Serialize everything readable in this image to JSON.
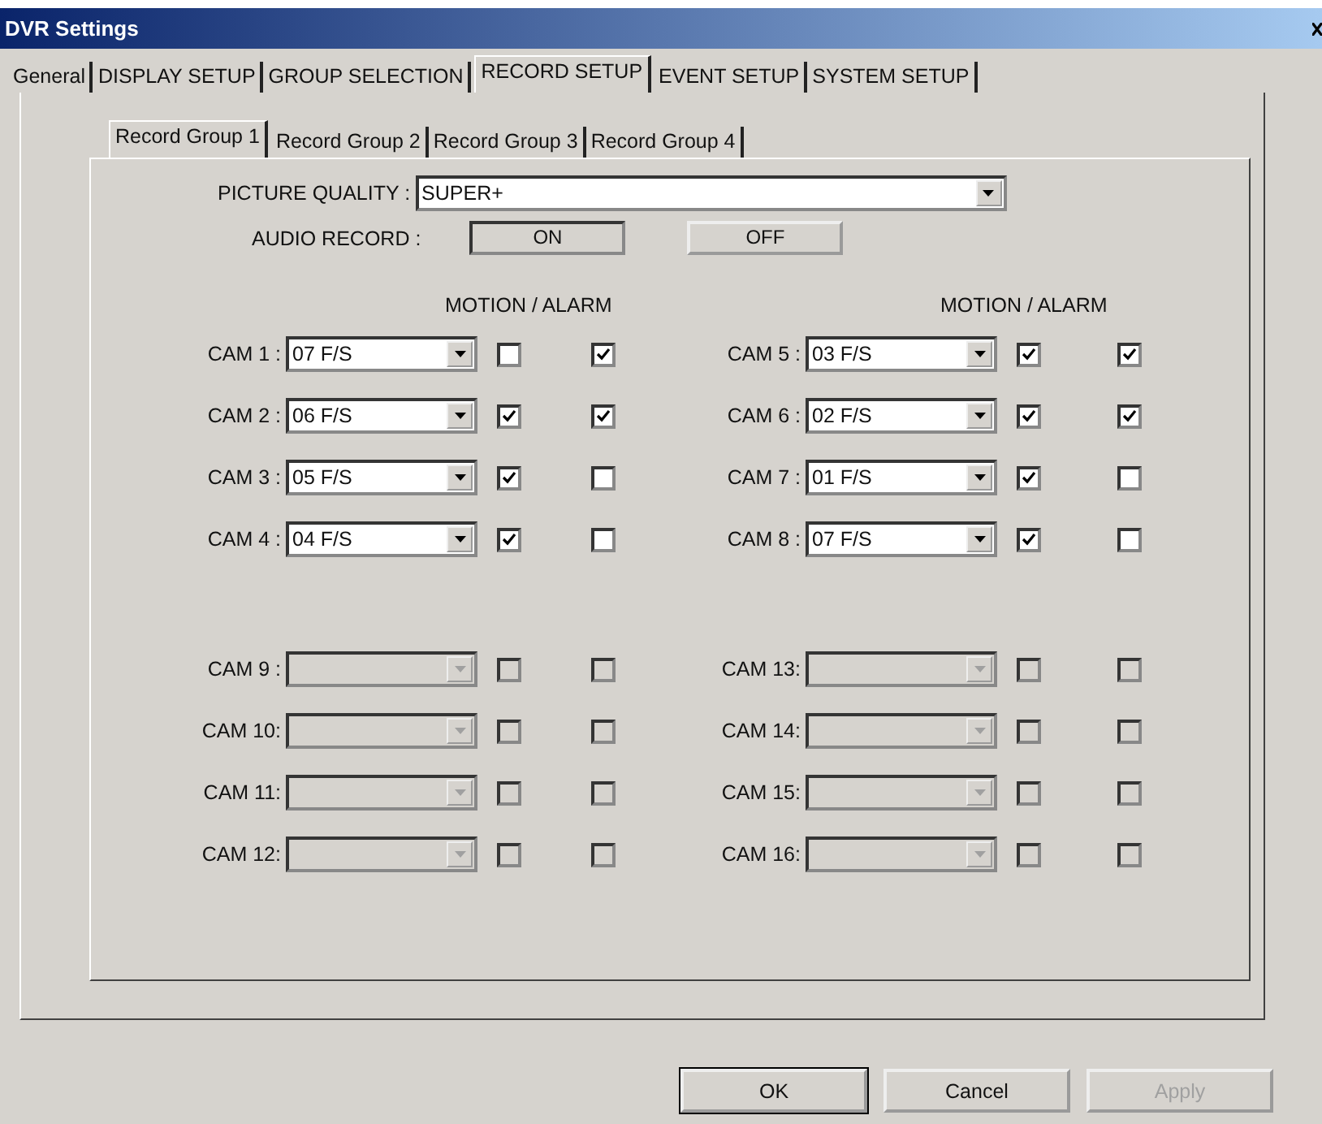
{
  "window": {
    "title": "DVR Settings"
  },
  "tabs": [
    {
      "label": "General",
      "selected": false
    },
    {
      "label": "DISPLAY SETUP",
      "selected": false
    },
    {
      "label": "GROUP SELECTION",
      "selected": false
    },
    {
      "label": "RECORD SETUP",
      "selected": true
    },
    {
      "label": "EVENT SETUP",
      "selected": false
    },
    {
      "label": "SYSTEM SETUP",
      "selected": false
    }
  ],
  "subtabs": [
    {
      "label": "Record Group 1",
      "selected": true
    },
    {
      "label": "Record Group 2",
      "selected": false
    },
    {
      "label": "Record Group 3",
      "selected": false
    },
    {
      "label": "Record Group 4",
      "selected": false
    }
  ],
  "picture_quality": {
    "label": "PICTURE QUALITY :",
    "value": "SUPER+"
  },
  "audio_record": {
    "label": "AUDIO RECORD :",
    "options": [
      {
        "label": "ON",
        "selected": true
      },
      {
        "label": "OFF",
        "selected": false
      }
    ]
  },
  "column_headers": [
    "MOTION / ALARM",
    "MOTION / ALARM"
  ],
  "cameras": [
    {
      "label": "CAM 1 :",
      "value": "07 F/S",
      "disabled": false,
      "motion": false,
      "alarm": true
    },
    {
      "label": "CAM 5 :",
      "value": "03 F/S",
      "disabled": false,
      "motion": true,
      "alarm": true
    },
    {
      "label": "CAM 2 :",
      "value": "06 F/S",
      "disabled": false,
      "motion": true,
      "alarm": true
    },
    {
      "label": "CAM 6 :",
      "value": "02 F/S",
      "disabled": false,
      "motion": true,
      "alarm": true
    },
    {
      "label": "CAM 3 :",
      "value": "05 F/S",
      "disabled": false,
      "motion": true,
      "alarm": false
    },
    {
      "label": "CAM 7 :",
      "value": "01 F/S",
      "disabled": false,
      "motion": true,
      "alarm": false
    },
    {
      "label": "CAM 4 :",
      "value": "04 F/S",
      "disabled": false,
      "motion": true,
      "alarm": false
    },
    {
      "label": "CAM 8 :",
      "value": "07 F/S",
      "disabled": false,
      "motion": true,
      "alarm": false
    },
    {
      "label": "CAM 9 :",
      "disabled": true,
      "motion": false,
      "alarm": false
    },
    {
      "label": "CAM 13:",
      "disabled": true,
      "motion": false,
      "alarm": false
    },
    {
      "label": "CAM 10:",
      "disabled": true,
      "motion": false,
      "alarm": false
    },
    {
      "label": "CAM 14:",
      "disabled": true,
      "motion": false,
      "alarm": false
    },
    {
      "label": "CAM 11:",
      "disabled": true,
      "motion": false,
      "alarm": false
    },
    {
      "label": "CAM 15:",
      "disabled": true,
      "motion": false,
      "alarm": false
    },
    {
      "label": "CAM 12:",
      "disabled": true,
      "motion": false,
      "alarm": false
    },
    {
      "label": "CAM 16:",
      "disabled": true,
      "motion": false,
      "alarm": false
    }
  ],
  "buttons": [
    {
      "label": "OK",
      "disabled": false
    },
    {
      "label": "Cancel",
      "disabled": false
    },
    {
      "label": "Apply",
      "disabled": true
    }
  ]
}
